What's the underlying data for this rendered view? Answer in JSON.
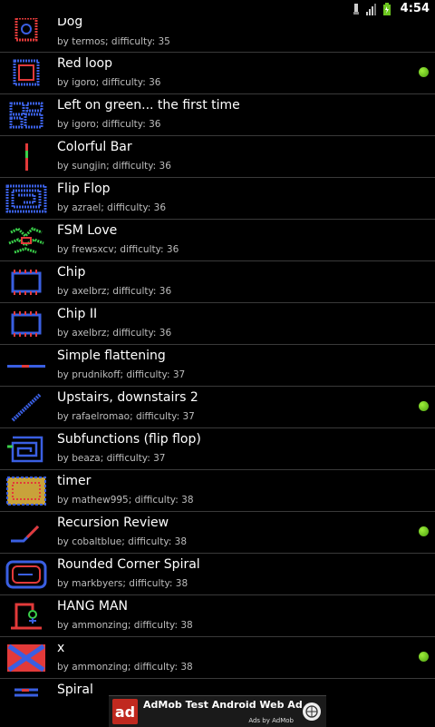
{
  "status_bar": {
    "time": "4:54"
  },
  "levels": [
    {
      "title": "Dog",
      "author": "by termos; difficulty: 35",
      "completed": false
    },
    {
      "title": "Red loop",
      "author": "by igoro; difficulty: 36",
      "completed": true
    },
    {
      "title": "Left on green... the first time",
      "author": "by igoro; difficulty: 36",
      "completed": false
    },
    {
      "title": "Colorful Bar",
      "author": "by sungjin; difficulty: 36",
      "completed": false
    },
    {
      "title": "Flip Flop",
      "author": "by azrael; difficulty: 36",
      "completed": false
    },
    {
      "title": "FSM Love",
      "author": "by frewsxcv; difficulty: 36",
      "completed": false
    },
    {
      "title": "Chip",
      "author": "by axelbrz; difficulty: 36",
      "completed": false
    },
    {
      "title": "Chip II",
      "author": "by axelbrz; difficulty: 36",
      "completed": false
    },
    {
      "title": "Simple flattening",
      "author": "by prudnikoff; difficulty: 37",
      "completed": false
    },
    {
      "title": "Upstairs, downstairs 2",
      "author": "by rafaelromao; difficulty: 37",
      "completed": true
    },
    {
      "title": "Subfunctions (flip flop)",
      "author": "by beaza; difficulty: 37",
      "completed": false
    },
    {
      "title": "timer",
      "author": "by mathew995; difficulty: 38",
      "completed": false
    },
    {
      "title": "Recursion Review",
      "author": "by cobaltblue; difficulty: 38",
      "completed": true
    },
    {
      "title": "Rounded Corner Spiral",
      "author": "by markbyers; difficulty: 38",
      "completed": false
    },
    {
      "title": "HANG MAN",
      "author": "by ammonzing; difficulty: 38",
      "completed": false
    },
    {
      "title": "x",
      "author": "by ammonzing; difficulty: 38",
      "completed": true
    },
    {
      "title": "Spiral",
      "author": "",
      "completed": false
    }
  ],
  "ad": {
    "logo": "ad",
    "title": "AdMob Test Android Web Ad",
    "subtitle": "Ads by AdMob"
  },
  "colors": {
    "completed_dot": "#6cc61f"
  }
}
